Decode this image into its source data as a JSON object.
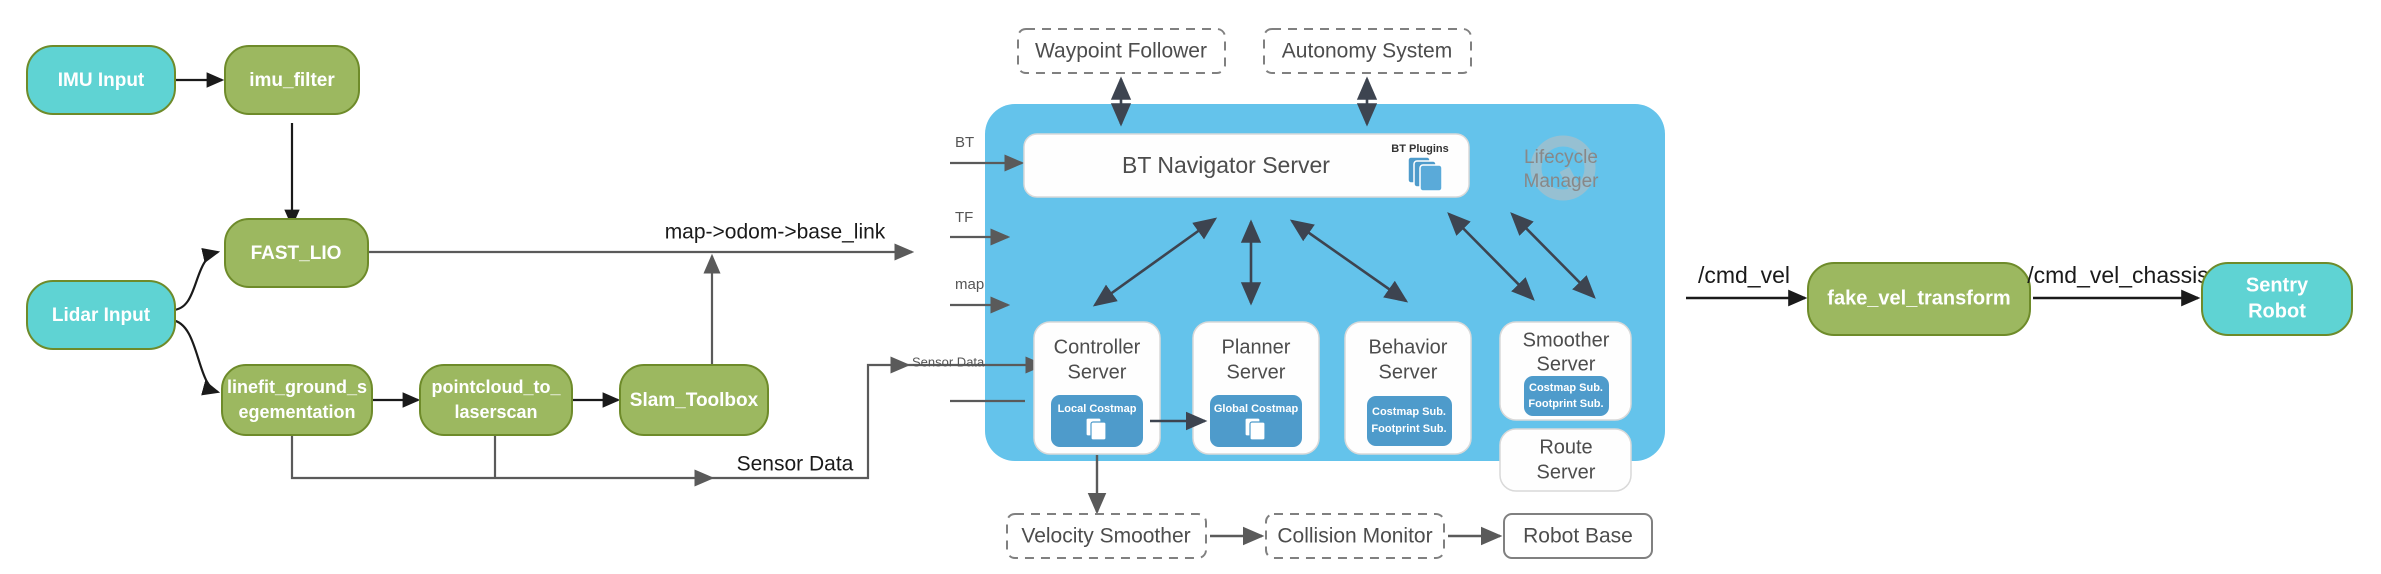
{
  "colors": {
    "teal_fill": "#5FD3D3",
    "green_fill": "#9CB860",
    "node_stroke": "#6E8B2A",
    "nav2_panel": "#64C3EB",
    "nav2_card": "#FEFEFE",
    "nav2_card_stroke": "#D9D9D9",
    "costmap_blue": "#4E9BCB",
    "arrow_dark": "#3D4450",
    "arrow_gray": "#5A5A5A",
    "dashed_stroke": "#808080",
    "text_gray": "#4D4D4D",
    "lifecycle_gray": "#BFBFBF",
    "white": "#FFFFFF"
  },
  "left_pipeline": {
    "nodes": [
      {
        "id": "imu_input",
        "label": "IMU Input",
        "kind": "teal"
      },
      {
        "id": "imu_filter",
        "label": "imu_filter",
        "kind": "green"
      },
      {
        "id": "lidar_input",
        "label": "Lidar Input",
        "kind": "teal"
      },
      {
        "id": "fast_lio",
        "label": "FAST_LIO",
        "kind": "green"
      },
      {
        "id": "linefit",
        "label": "linefit_ground_s",
        "label2": "egementation",
        "kind": "green"
      },
      {
        "id": "pc2ls",
        "label": "pointcloud_to_",
        "label2": "laserscan",
        "kind": "green"
      },
      {
        "id": "slam_toolbox",
        "label": "Slam_Toolbox",
        "kind": "green"
      }
    ],
    "edge_labels": {
      "tf_chain": "map->odom->base_link",
      "sensor_data": "Sensor Data"
    }
  },
  "nav2": {
    "external_top": [
      {
        "id": "waypoint_follower",
        "label": "Waypoint Follower"
      },
      {
        "id": "autonomy_system",
        "label": "Autonomy System"
      }
    ],
    "inputs": [
      {
        "id": "bt",
        "label": "BT"
      },
      {
        "id": "tf",
        "label": "TF"
      },
      {
        "id": "map",
        "label": "map"
      },
      {
        "id": "sensor_data",
        "label": "Sensor Data"
      }
    ],
    "bt_navigator": {
      "title": "BT Navigator Server",
      "plugin_label": "BT Plugins",
      "plugin_icon": "stacked-cards-icon"
    },
    "lifecycle_manager": {
      "line1": "Lifecycle",
      "line2": "Manager",
      "icon": "lifecycle-loop-icon"
    },
    "servers": [
      {
        "id": "controller_server",
        "title1": "Controller",
        "title2": "Server",
        "badge": {
          "label": "Local Costmap",
          "icon": "stacked-cards-icon",
          "lines": 1
        }
      },
      {
        "id": "planner_server",
        "title1": "Planner",
        "title2": "Server",
        "badge": {
          "label": "Global Costmap",
          "icon": "stacked-cards-icon",
          "lines": 1
        }
      },
      {
        "id": "behavior_server",
        "title1": "Behavior",
        "title2": "Server",
        "badge": {
          "label": "Costmap Sub.",
          "label2": "Footprint Sub.",
          "lines": 2
        }
      },
      {
        "id": "smoother_server",
        "title1": "Smoother",
        "title2": "Server",
        "badge": {
          "label": "Costmap Sub.",
          "label2": "Footprint Sub.",
          "lines": 2
        }
      },
      {
        "id": "route_server",
        "title1": "Route",
        "title2": "Server"
      }
    ],
    "external_bottom": [
      {
        "id": "velocity_smoother",
        "label": "Velocity Smoother",
        "style": "dashed"
      },
      {
        "id": "collision_monitor",
        "label": "Collision Monitor",
        "style": "dashed"
      },
      {
        "id": "robot_base",
        "label": "Robot Base",
        "style": "solid"
      }
    ]
  },
  "right_pipeline": {
    "nodes": [
      {
        "id": "fake_vel_transform",
        "label": "fake_vel_transform",
        "kind": "green"
      },
      {
        "id": "sentry_robot",
        "label": "Sentry",
        "label2": "Robot",
        "kind": "teal"
      }
    ],
    "edge_labels": {
      "cmd_vel": "/cmd_vel",
      "cmd_vel_chassis": "/cmd_vel_chassis"
    }
  }
}
